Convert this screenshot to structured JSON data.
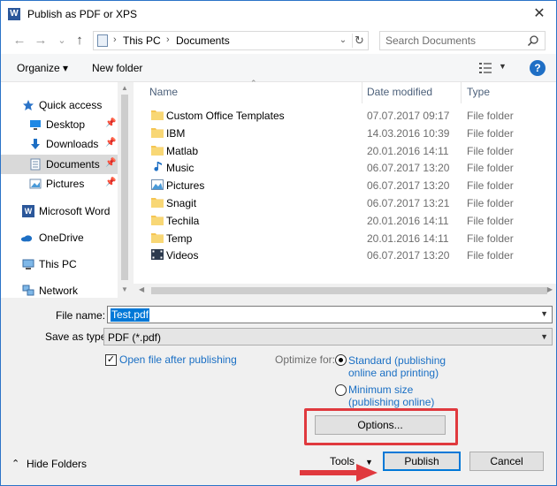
{
  "window": {
    "title": "Publish as PDF or XPS",
    "app_icon": "word-icon",
    "close_glyph": "✕"
  },
  "nav": {
    "back_glyph": "←",
    "forward_glyph": "→",
    "recent_glyph": "⌄",
    "up_glyph": "↑",
    "breadcrumb": [
      "This PC",
      "Documents"
    ],
    "crumb_sep": "›",
    "refresh_glyph": "↻",
    "dropdown_glyph": "⌄"
  },
  "search": {
    "placeholder": "Search Documents",
    "icon": "search-icon"
  },
  "toolbar": {
    "organize_label": "Organize ▾",
    "new_folder_label": "New folder",
    "view_icon": "view-options-icon",
    "view_drop": "▼",
    "help_label": "?"
  },
  "sidebar": {
    "items": [
      {
        "label": "Quick access",
        "icon": "star-icon",
        "color": "#2b73c7"
      },
      {
        "label": "Desktop",
        "icon": "desktop-icon",
        "pinned": true
      },
      {
        "label": "Downloads",
        "icon": "download-icon",
        "pinned": true
      },
      {
        "label": "Documents",
        "icon": "documents-icon",
        "pinned": true,
        "selected": true
      },
      {
        "label": "Pictures",
        "icon": "pictures-icon",
        "pinned": true
      },
      {
        "label": "Microsoft Word",
        "icon": "word-icon"
      },
      {
        "label": "OneDrive",
        "icon": "cloud-icon"
      },
      {
        "label": "This PC",
        "icon": "computer-icon"
      },
      {
        "label": "Network",
        "icon": "network-icon"
      }
    ],
    "pin_glyph": "📌"
  },
  "columns": {
    "name": "Name",
    "date": "Date modified",
    "type": "Type"
  },
  "files": [
    {
      "name": "Custom Office Templates",
      "date": "07.07.2017 09:17",
      "type": "File folder",
      "icon": "folder-icon"
    },
    {
      "name": "IBM",
      "date": "14.03.2016 10:39",
      "type": "File folder",
      "icon": "folder-icon"
    },
    {
      "name": "Matlab",
      "date": "20.01.2016 14:11",
      "type": "File folder",
      "icon": "folder-icon"
    },
    {
      "name": "Music",
      "date": "06.07.2017 13:20",
      "type": "File folder",
      "icon": "music-icon"
    },
    {
      "name": "Pictures",
      "date": "06.07.2017 13:20",
      "type": "File folder",
      "icon": "pictures-icon"
    },
    {
      "name": "Snagit",
      "date": "06.07.2017 13:21",
      "type": "File folder",
      "icon": "folder-icon"
    },
    {
      "name": "Techila",
      "date": "20.01.2016 14:11",
      "type": "File folder",
      "icon": "folder-icon"
    },
    {
      "name": "Temp",
      "date": "20.01.2016 14:11",
      "type": "File folder",
      "icon": "folder-icon"
    },
    {
      "name": "Videos",
      "date": "06.07.2017 13:20",
      "type": "File folder",
      "icon": "videos-icon"
    }
  ],
  "form": {
    "filename_label": "File name:",
    "filename_value": "Test.pdf",
    "savetype_label": "Save as type:",
    "savetype_value": "PDF (*.pdf)",
    "open_after_label": "Open file after publishing",
    "open_after_checked": true,
    "optimize_label": "Optimize for:",
    "standard_line1": "Standard (publishing",
    "standard_line2": "online and printing)",
    "minimum_line1": "Minimum size",
    "minimum_line2": "(publishing online)",
    "selected_optimization": "standard",
    "options_label": "Options..."
  },
  "footer": {
    "hide_folders_label": "Hide Folders",
    "hide_glyph": "⌃",
    "tools_label": "Tools",
    "tools_drop": "▼",
    "publish_label": "Publish",
    "cancel_label": "Cancel"
  },
  "colors": {
    "accent": "#0078d7",
    "link": "#1a6fc4",
    "highlight_box": "#e0393e",
    "folder": "#f5c553"
  }
}
